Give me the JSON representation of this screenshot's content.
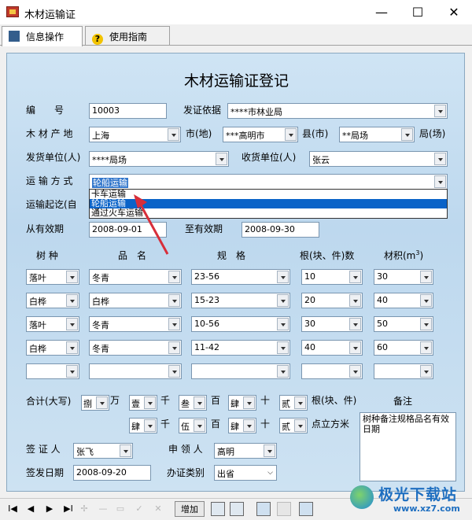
{
  "window": {
    "title": "木材运输证",
    "minimize": "—",
    "maximize": "☐",
    "close": "✕"
  },
  "tabs": [
    {
      "label": "信息操作",
      "icon": "document-icon"
    },
    {
      "label": "使用指南",
      "icon": "help-icon"
    }
  ],
  "form": {
    "title": "木材运输证登记",
    "number_label": "编　　号",
    "number_value": "10003",
    "basis_label": "发证依据",
    "basis_value": "****市林业局",
    "origin_label": "木 材 产 地",
    "province_value": "上海",
    "city_label": "市(地)",
    "city_value": "***高明市",
    "county_label": "县(市)",
    "county_value": "**局场",
    "farm_label": "局(场)",
    "sender_label": "发货单位(人)",
    "sender_value": "****局场",
    "receiver_label": "收货单位(人)",
    "receiver_value": "张云",
    "transport_label": "运 输 方 式",
    "transport_value": "轮船运输",
    "route_label": "运输起讫(自",
    "valid_from_label": "从有效期",
    "valid_from_value": "2008-09-01",
    "valid_to_label": "至有效期",
    "valid_to_value": "2008-09-30",
    "dropdown_options": [
      "卡车运输",
      "轮船运输",
      "通过火车运输"
    ],
    "col_species": "树 种",
    "col_product": "品　名",
    "col_spec": "规　格",
    "col_count": "根(块、件)数",
    "col_volume": "材积(m",
    "col_volume_sup": "3",
    "col_volume_end": ")",
    "rows": [
      {
        "species": "落叶",
        "product": "冬青",
        "spec": "23-56",
        "count": "10",
        "volume": "30"
      },
      {
        "species": "白桦",
        "product": "白桦",
        "spec": "15-23",
        "count": "20",
        "volume": "40"
      },
      {
        "species": "落叶",
        "product": "冬青",
        "spec": "10-56",
        "count": "30",
        "volume": "50"
      },
      {
        "species": "白桦",
        "product": "冬青",
        "spec": "11-42",
        "count": "40",
        "volume": "60"
      },
      {
        "species": "",
        "product": "",
        "spec": "",
        "count": "",
        "volume": ""
      }
    ],
    "total_label": "合计(大写)",
    "total_digits_1": [
      "捌",
      "壹",
      "叁",
      "肆",
      "贰"
    ],
    "total_units_1": [
      "万",
      "千",
      "百",
      "十",
      "根(块、件)"
    ],
    "total_digits_2": [
      "肆",
      "伍",
      "肆",
      "贰"
    ],
    "total_units_2": [
      "千",
      "百",
      "十",
      "点立方米"
    ],
    "remarks_label": "备注",
    "remarks_value": "树种备注规格品名有效日期",
    "issuer_label": "签 证 人",
    "issuer_value": "张飞",
    "applicant_label": "申 领 人",
    "applicant_value": "高明",
    "issue_date_label": "签发日期",
    "issue_date_value": "2008-09-20",
    "category_label": "办证类别",
    "category_value": "出省"
  },
  "toolbar": {
    "first": "I◀",
    "prev": "◀",
    "next": "▶",
    "last": "▶I",
    "add_symbol": "✢",
    "minus": "—",
    "add": "增加"
  },
  "watermark": {
    "brand": "极光下载站",
    "url": "www.xz7.com"
  }
}
